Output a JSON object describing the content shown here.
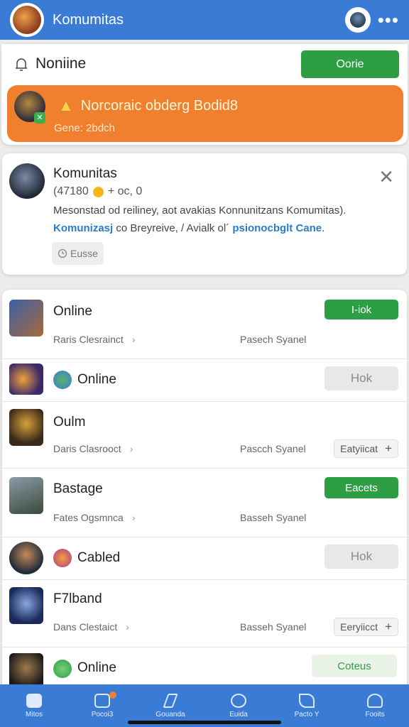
{
  "header": {
    "title": "Komumitas",
    "more_icon": "more-dots-icon"
  },
  "featured": {
    "nonline_label": "Noniine",
    "nonline_button": "Oorie",
    "banner_title": "Norcoraic obderg Bodid8",
    "banner_subtitle": "Gene: 2bdch"
  },
  "info_card": {
    "title": "Komunitas",
    "stat_left": "(47180",
    "stat_right": "+ oc, 0",
    "desc_line1": "Mesonstad od reiliney, aot avakias Konnunitzans Komumitas).",
    "desc_line2_blue1": "Komunizasj",
    "desc_line2_mid": " co Breyreive, / Avialk ol´ ",
    "desc_line2_blue2": "psionocbglt Cane",
    "desc_line2_end": ".",
    "tag_label": "Eusse"
  },
  "list": {
    "rows": [
      {
        "title": "Online",
        "sub_left": "Raris Clesrainct",
        "sub_mid": "Pasech Syanel",
        "button": "I-iok"
      },
      {
        "title": "Online",
        "button": "Hok"
      },
      {
        "title": "Oulm",
        "sub_left": "Daris Clasrooct",
        "sub_mid": "Pascch Syanel",
        "chip": "Eatyiicat"
      },
      {
        "title": "Bastage",
        "sub_left": "Fates Ogsmnca",
        "sub_mid": "Basseh Syanel",
        "button": "Eacets"
      },
      {
        "title": "Cabled",
        "button": "Hok"
      },
      {
        "title": "F7lband",
        "sub_left": "Dans Clestaict",
        "sub_mid": "Basseh Syanel",
        "chip": "Eeryiicct"
      },
      {
        "title": "Online",
        "button": "Coteus"
      }
    ]
  },
  "bottom_nav": {
    "tabs": [
      {
        "label": "Mitos"
      },
      {
        "label": "Pocoi3"
      },
      {
        "label": "Gouanda"
      },
      {
        "label": "Euida"
      },
      {
        "label": "Pacto Y"
      },
      {
        "label": "Fooits"
      }
    ]
  },
  "colors": {
    "primary_blue": "#3a7bd5",
    "banner_orange": "#f07f2e",
    "action_green": "#2e9e44",
    "link_blue": "#2a7cc7"
  }
}
